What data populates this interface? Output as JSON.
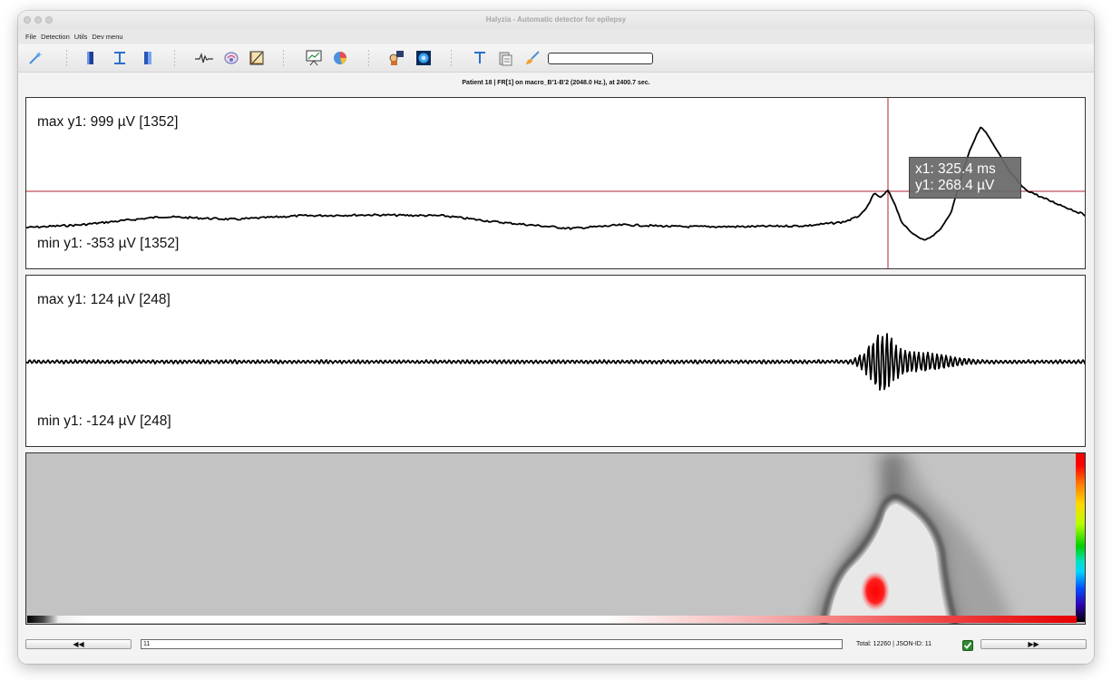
{
  "window": {
    "title": "Halyzia - Automatic detector for epilepsy"
  },
  "menu": [
    "File",
    "Detection",
    "Utils",
    "Dev menu"
  ],
  "toolbar": {
    "icons": [
      "magic-wand-icon",
      "bookmark-icon",
      "text-cursor-icon",
      "bookmark-alt-icon",
      "waveform-icon",
      "brain-settings-icon",
      "draw-tool-icon",
      "chart-presentation-icon",
      "pie-chart-icon",
      "robot-icon",
      "brain-scan-icon",
      "text-align-icon",
      "clipboard-icon",
      "brush-icon"
    ],
    "search_value": ""
  },
  "info_line": "Patient 18   |   FR[1] on macro_B'1-B'2 (2048.0 Hz.), at 2400.7 sec.",
  "panels": {
    "raw": {
      "max_label": "max y1: 999 µV [1352]",
      "min_label": "min y1: -353 µV [1352]"
    },
    "filtered": {
      "max_label": "max y1: 124 µV [248]",
      "min_label": "min y1: -124 µV [248]"
    }
  },
  "cursor": {
    "x_label": "x1: 325.4 ms",
    "y_label": "y1: 268.4 µV"
  },
  "spectrogram": {
    "colormap_top": "#ff0000",
    "colormap_bottom": "#000000"
  },
  "colors": {
    "crosshair": "#b02030",
    "trace": "#000000",
    "hotspot": "#ff0000",
    "background": "#c3c3c3"
  },
  "bottom": {
    "prev_label": "◀◀",
    "next_label": "▶▶",
    "page_value": "11",
    "total": "Total: 12260   |   JSON-ID: 11",
    "validated": true
  }
}
